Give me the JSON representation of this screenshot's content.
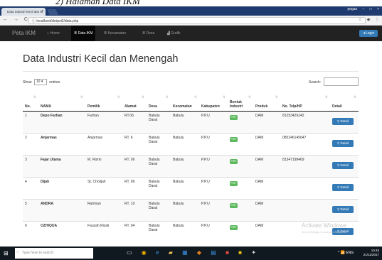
{
  "caption": "2) Halaman Data IKM",
  "browser": {
    "tab_title": "Data Industri Kecil dan M",
    "tab_close": "×",
    "url": "localhost/skripsi2/data.php",
    "window_user": "pegas",
    "window_controls": [
      "–",
      "□",
      "×"
    ],
    "nav_icons": [
      "back-arrow-icon",
      "forward-arrow-icon",
      "reload-icon"
    ],
    "addr_icons": [
      "star-icon",
      "extension-icon",
      "menu-icon"
    ]
  },
  "navbar": {
    "brand": "Peta IKM",
    "items": [
      {
        "label": "Home",
        "icon": "home-icon"
      },
      {
        "label": "Data IKM",
        "icon": "list-icon"
      },
      {
        "label": "Kecamatan",
        "icon": "list-icon"
      },
      {
        "label": "Desa",
        "icon": "list-icon"
      },
      {
        "label": "Grafik",
        "icon": "chart-icon"
      }
    ],
    "active_index": 1,
    "login": "Login"
  },
  "page": {
    "title": "Data Industri Kecil dan Menengah",
    "show_prefix": "Show",
    "show_value": "10",
    "show_suffix": "entries",
    "search_label": "Search:"
  },
  "table": {
    "headers": [
      "No.",
      "NAMA",
      "Pemilik",
      "Alamat",
      "Desa",
      "Kecamatan",
      "Kabupaten",
      "Bentuk Industri",
      "Produk",
      "No. Telp/HP",
      "Detail"
    ],
    "rows": [
      {
        "no": "1",
        "nama": "Depo Farhan",
        "pemilik": "Farhan",
        "alamat": "RT.06",
        "desa": "Babulu Darat",
        "kecamatan": "Babulu",
        "kabupaten": "P.P.U",
        "bentuk": "PIRT",
        "produk": "DAM",
        "telp": "81253426242",
        "detail": "Detail"
      },
      {
        "no": "2",
        "nama": "Anjarmas",
        "pemilik": "Anjarmas",
        "alamat": "RT. 6",
        "desa": "Babulu Darat",
        "kecamatan": "Babulu",
        "kabupaten": "P.P.U",
        "bentuk": "PIRT",
        "produk": "DAM",
        "telp": "085246145647",
        "detail": "Detail"
      },
      {
        "no": "3",
        "nama": "Fajar Utama",
        "pemilik": "M. Rismi",
        "alamat": "RT. 06",
        "desa": "Babulu Darat",
        "kecamatan": "Babulu",
        "kabupaten": "P.P.U",
        "bentuk": "PIRT",
        "produk": "DAM",
        "telp": "81347198469",
        "detail": "Detail"
      },
      {
        "no": "4",
        "nama": "Dijah",
        "pemilik": "St. Cholijah",
        "alamat": "RT. 06",
        "desa": "Babulu Darat",
        "kecamatan": "Babulu",
        "kabupaten": "P.P.U",
        "bentuk": "PIRT",
        "produk": "DAM",
        "telp": "",
        "detail": "Detail"
      },
      {
        "no": "5",
        "nama": "ANDRA",
        "pemilik": "Rahman",
        "alamat": "RT. 10",
        "desa": "Babulu Darat",
        "kecamatan": "Babulu",
        "kabupaten": "P.P.U",
        "bentuk": "PIRT",
        "produk": "DAM",
        "telp": "",
        "detail": "Detail"
      },
      {
        "no": "6",
        "nama": "OZHIQUA",
        "pemilik": "Fauzah Rizali",
        "alamat": "RT. 04",
        "desa": "Babulu Darat",
        "kecamatan": "Babulu",
        "kabupaten": "P.P.U",
        "bentuk": "PIRT",
        "produk": "DAM",
        "telp": "",
        "detail": "Detail"
      }
    ]
  },
  "watermark": {
    "title": "Activate Windows",
    "subtitle": "Go to Settings to activate Windows."
  },
  "taskbar": {
    "search_placeholder": "Type here to search",
    "time": "10:45",
    "date": "21/11/2017",
    "lang": "ENG"
  }
}
